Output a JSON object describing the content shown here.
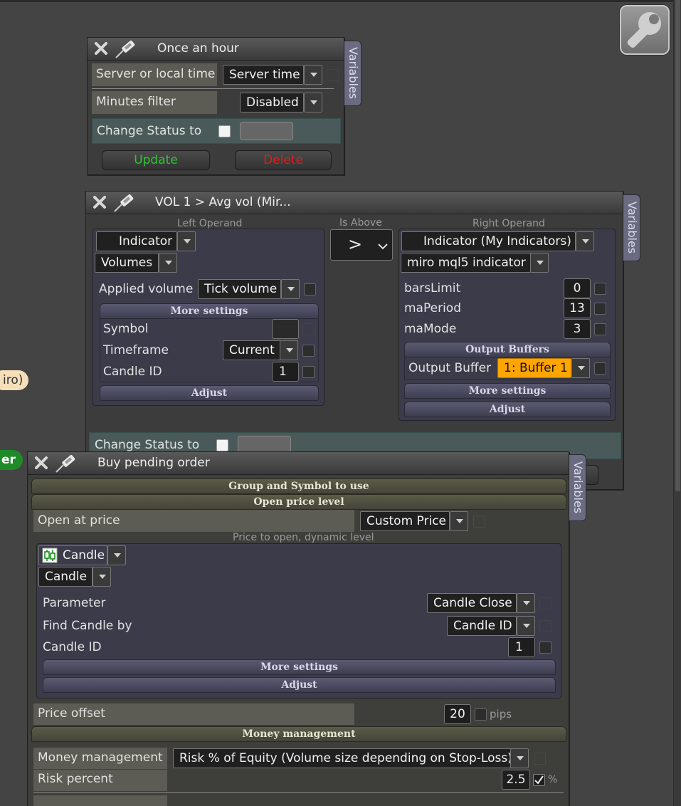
{
  "settings": {
    "icon": "wrench-icon"
  },
  "fragments": {
    "miro": "iro)",
    "green": "er"
  },
  "panel_once": {
    "title": "Once an hour",
    "variables_tab": "Variables",
    "server_local_label": "Server or local time",
    "server_local_value": "Server time",
    "minutes_filter_label": "Minutes filter",
    "minutes_filter_value": "Disabled",
    "change_status_label": "Change Status to",
    "update_label": "Update",
    "delete_label": "Delete",
    "colors": {
      "update": "#2fc52f",
      "delete": "#e01b1b"
    }
  },
  "panel_vol": {
    "title": "VOL 1 > Avg vol (Mir...",
    "variables_tab": "Variables",
    "left_operand_caption": "Left Operand",
    "is_above_caption": "Is Above",
    "right_operand_caption": "Right Operand",
    "operator_value": ">",
    "left": {
      "source_value": "Indicator",
      "indicator_value": "Volumes",
      "applied_volume_label": "Applied volume",
      "applied_volume_value": "Tick volume",
      "more_settings_label": "More settings",
      "symbol_label": "Symbol",
      "timeframe_label": "Timeframe",
      "timeframe_value": "Current",
      "candle_id_label": "Candle ID",
      "candle_id_value": "1",
      "adjust_label": "Adjust"
    },
    "right": {
      "source_value": "Indicator (My Indicators)",
      "indicator_value": "miro mql5 indicator",
      "params": [
        {
          "label": "barsLimit",
          "value": "0"
        },
        {
          "label": "maPeriod",
          "value": "13"
        },
        {
          "label": "maMode",
          "value": "3"
        }
      ],
      "output_buffers_label": "Output Buffers",
      "output_buffer_label": "Output Buffer",
      "output_buffer_value": "1: Buffer 1",
      "more_settings_label": "More settings",
      "adjust_label": "Adjust",
      "colors": {
        "output_buffer_bg": "#ffa500"
      }
    },
    "change_status_label": "Change Status to"
  },
  "panel_buy": {
    "title": "Buy pending order",
    "variables_tab": "Variables",
    "group_symbol_label": "Group and Symbol to use",
    "open_price_level_label": "Open price level",
    "open_at_price_label": "Open at price",
    "open_at_price_value": "Custom Price",
    "price_dynamic_caption": "Price to open, dynamic level",
    "source_value": "Candle",
    "source_sub_value": "Candle",
    "parameter_label": "Parameter",
    "parameter_value": "Candle Close",
    "find_candle_label": "Find Candle by",
    "find_candle_value": "Candle ID",
    "candle_id_label": "Candle ID",
    "candle_id_value": "1",
    "more_settings_label": "More settings",
    "adjust_label": "Adjust",
    "price_offset_label": "Price offset",
    "price_offset_value": "20",
    "price_offset_unit": "pips",
    "money_management_section": "Money management",
    "money_management_label": "Money management",
    "money_management_value": "Risk % of Equity (Volume size depending on Stop-Loss)",
    "risk_percent_label": "Risk percent",
    "risk_percent_value": "2.5",
    "risk_percent_unit": "%"
  }
}
